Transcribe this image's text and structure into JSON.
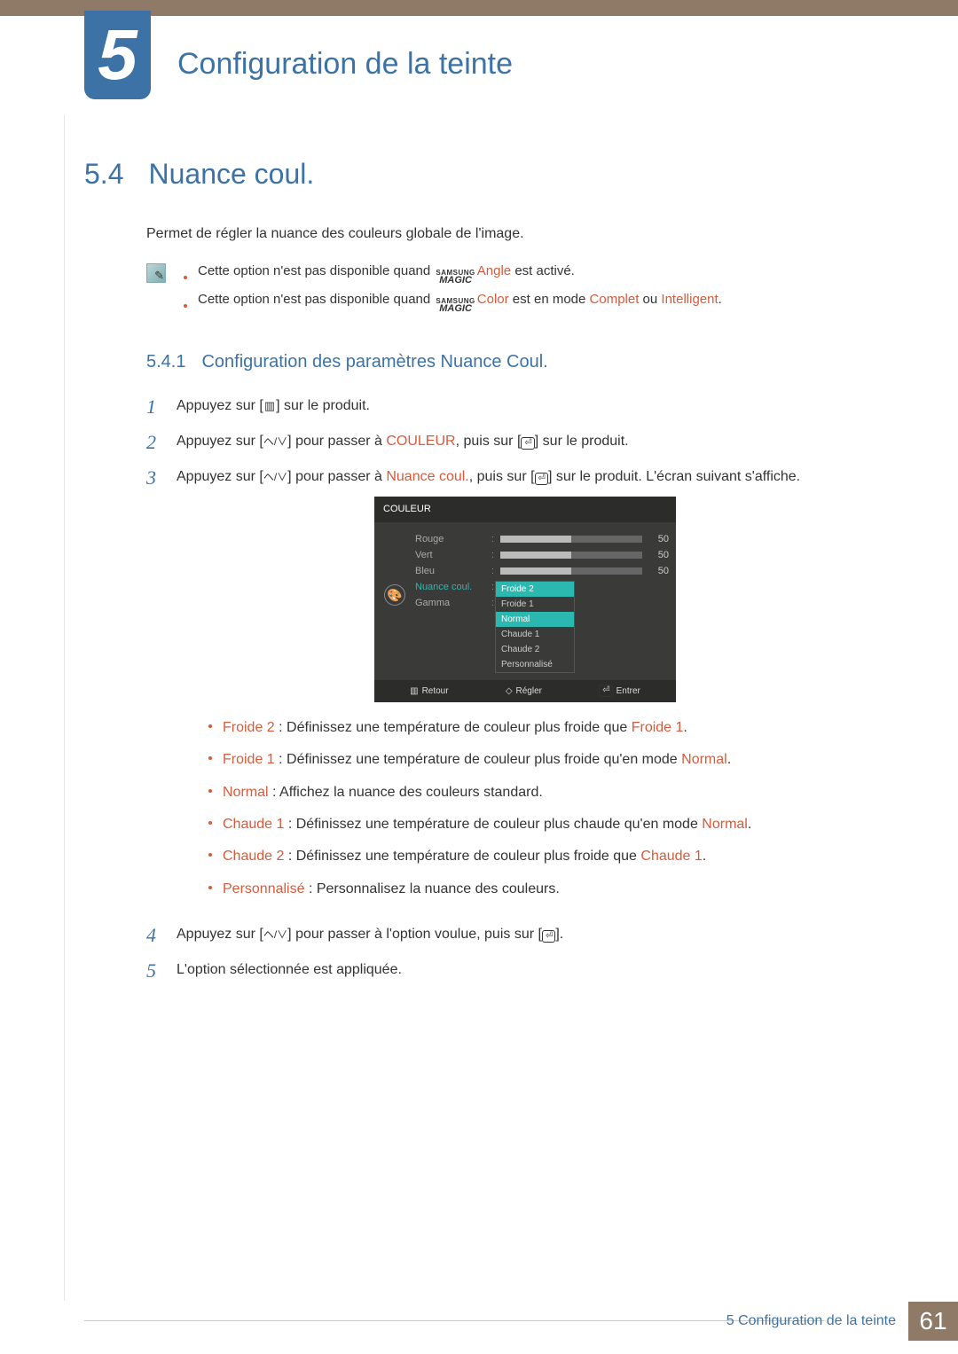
{
  "chapter": {
    "number": "5",
    "title": "Configuration de la teinte"
  },
  "section": {
    "number": "5.4",
    "title": "Nuance coul."
  },
  "intro": "Permet de régler la nuance des couleurs globale de l'image.",
  "magic": {
    "top": "SAMSUNG",
    "bottom": "MAGIC"
  },
  "notes": {
    "n1_pre": "Cette option n'est pas disponible quand ",
    "n1_term": "Angle",
    "n1_post": " est activé.",
    "n2_pre": "Cette option n'est pas disponible quand ",
    "n2_term": "Color",
    "n2_mid": " est en mode ",
    "n2_opt1": "Complet",
    "n2_or": " ou ",
    "n2_opt2": "Intelligent",
    "n2_end": "."
  },
  "subsection": {
    "number": "5.4.1",
    "title": "Configuration des paramètres Nuance Coul."
  },
  "steps": {
    "s1": "Appuyez sur [",
    "s1b": "] sur le produit.",
    "s2a": "Appuyez sur [",
    "s2b": "] pour passer à ",
    "s2c": "COULEUR",
    "s2d": ", puis sur [",
    "s2e": "] sur le produit.",
    "s3a": "Appuyez sur [",
    "s3b": "] pour passer à ",
    "s3c": "Nuance coul.",
    "s3d": ", puis sur [",
    "s3e": "] sur le produit. L'écran suivant s'affiche.",
    "s4a": "Appuyez sur [",
    "s4b": "] pour passer à l'option voulue, puis sur [",
    "s4c": "].",
    "s5": "L'option sélectionnée est appliquée."
  },
  "osd": {
    "title": "COULEUR",
    "rows": {
      "rouge": "Rouge",
      "vert": "Vert",
      "bleu": "Bleu",
      "nuance": "Nuance coul.",
      "gamma": "Gamma"
    },
    "val": "50",
    "options": [
      "Froide 2",
      "Froide 1",
      "Normal",
      "Chaude 1",
      "Chaude 2",
      "Personnalisé"
    ],
    "footer": {
      "retour": "Retour",
      "regler": "Régler",
      "entrer": "Entrer"
    }
  },
  "descs": {
    "d1k": "Froide 2",
    "d1v": " : Définissez une température de couleur plus froide que ",
    "d1r": "Froide 1",
    "d1e": ".",
    "d2k": "Froide 1",
    "d2v": " : Définissez une température de couleur plus froide qu'en mode ",
    "d2r": "Normal",
    "d2e": ".",
    "d3k": "Normal",
    "d3v": " : Affichez la nuance des couleurs standard.",
    "d4k": "Chaude 1",
    "d4v": " : Définissez une température de couleur plus chaude qu'en mode ",
    "d4r": "Normal",
    "d4e": ".",
    "d5k": "Chaude 2",
    "d5v": " : Définissez une température de couleur plus froide que ",
    "d5r": "Chaude 1",
    "d5e": ".",
    "d6k": "Personnalisé",
    "d6v": " : Personnalisez la nuance des couleurs."
  },
  "footer": {
    "text": "5 Configuration de la teinte",
    "page": "61"
  }
}
